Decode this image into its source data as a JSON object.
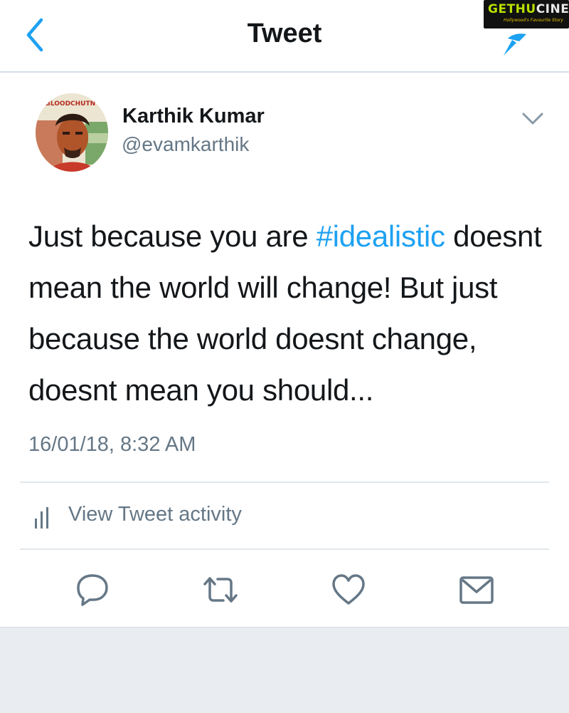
{
  "header": {
    "title": "Tweet"
  },
  "watermark": {
    "brand_part1": "GETHU",
    "brand_part2": "CINEMA",
    "tagline": "Hollywood's Favourite Story"
  },
  "avatar": {
    "banner_text": "BLOODCHUTN"
  },
  "tweet": {
    "user_name": "Karthik Kumar",
    "handle": "@evamkarthik",
    "text_before_hashtag": "Just because you are ",
    "hashtag": "#idealistic",
    "text_after_hashtag": " doesnt mean the world will change! But just because the world doesnt change, doesnt mean you should...",
    "timestamp": "16/01/18, 8:32 AM"
  },
  "activity": {
    "label": "View Tweet activity"
  },
  "actions": {
    "icons": [
      "reply-icon",
      "retweet-icon",
      "like-icon",
      "message-icon"
    ]
  },
  "colors": {
    "accent": "#1da1f2",
    "secondary_text": "#657786",
    "divider": "#e1e8ed",
    "footer_bg": "#e9ecf1"
  }
}
